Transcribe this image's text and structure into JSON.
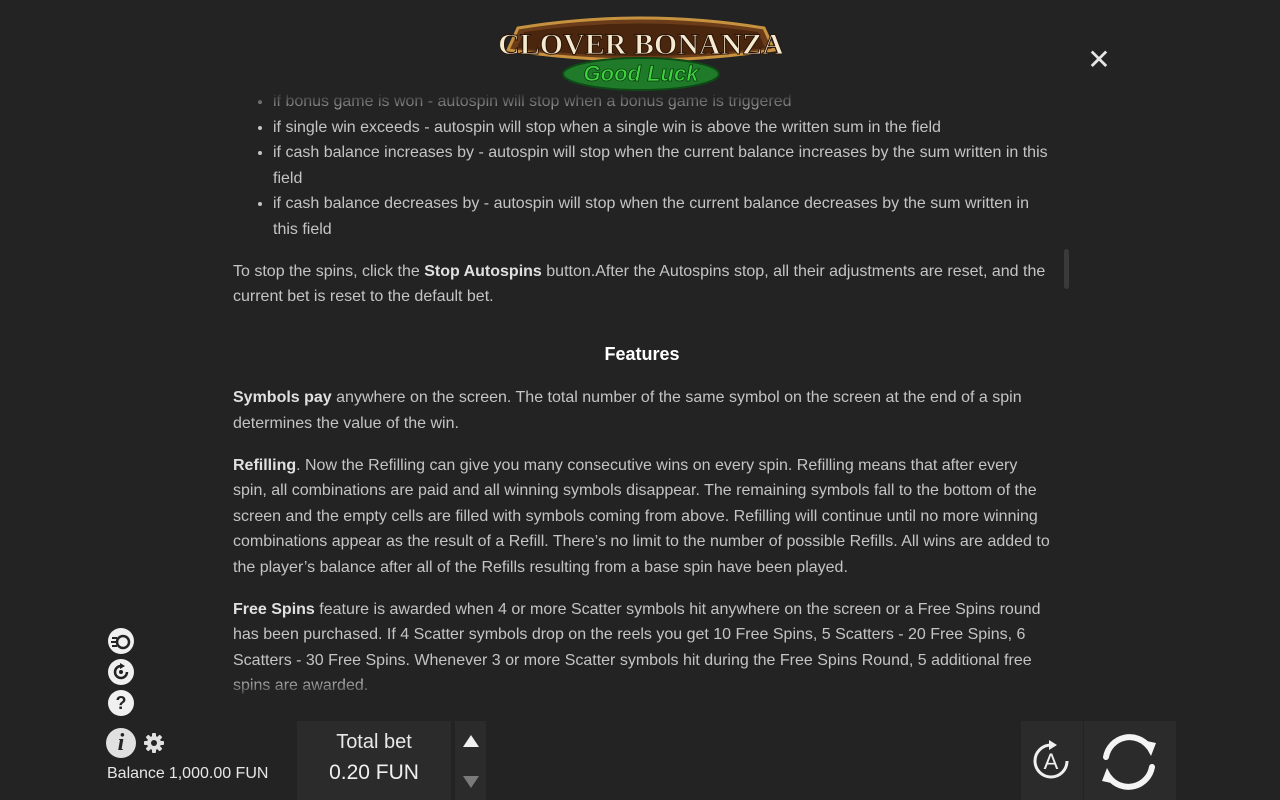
{
  "logo": {
    "line1": "CLOVER BONANZA",
    "line2": "Good Luck"
  },
  "close": {
    "icon": "close-icon",
    "glyph": "✕"
  },
  "rules": {
    "bullets": [
      "if bonus game is won - autospin will stop when a bonus game is triggered",
      "if single win exceeds - autospin will stop when a single win is above the written sum in the field",
      "if cash balance increases by - autospin will stop when the current balance increases by the sum written in this field",
      "if cash balance decreases by - autospin will stop when the current balance decreases by the sum written in this field"
    ],
    "stop_para": {
      "prefix": "To stop the spins, click the ",
      "bold": "Stop Autospins",
      "suffix": " button.After the Autospins stop, all their adjustments are reset, and the current bet is reset to the default bet."
    },
    "features_title": "Features",
    "symbols_para": {
      "bold": "Symbols pay",
      "text": " anywhere on the screen. The total number of the same symbol on the screen at the end of a spin determines the value of the win."
    },
    "refill_para": {
      "bold": "Refilling",
      "text": ". Now the Refilling can give you many consecutive wins on every spin. Refilling means that after every spin, all combinations are paid and all winning symbols disappear. The remaining symbols fall to the bottom of the screen and the empty cells are filled with symbols coming from above. Refilling will continue until no more winning combinations appear as the result of a Refill. There’s no limit to the number of possible Refills. All wins are added to the player’s balance after all of the Refills resulting from a base spin have been played."
    },
    "freespins_para": {
      "bold": "Free Spins",
      "text": " feature is awarded when 4 or more Scatter symbols hit anywhere on the screen or a Free Spins round has been purchased. If 4 Scatter symbols drop on the reels you get 10 Free Spins, 5 Scatters - 20 Free Spins, 6 Scatters - 30 Free Spins. Whenever 3 or more Scatter symbols hit during the Free Spins Round, 5 additional free spins are awarded."
    }
  },
  "side_icons": {
    "turbo": "turbo-icon",
    "history": "history-icon",
    "help": {
      "icon": "help-icon",
      "glyph": "?"
    },
    "info": {
      "icon": "info-icon",
      "glyph": "i"
    },
    "settings": "gear-icon"
  },
  "balance": {
    "label": "Balance",
    "value": "1,000.00 FUN"
  },
  "bet": {
    "label": "Total bet",
    "value": "0.20 FUN"
  },
  "autoplay": {
    "icon": "autoplay-icon",
    "glyph": "A"
  },
  "spin": {
    "icon": "spin-icon"
  },
  "colors": {
    "background": "#232323",
    "panel": "#2b2b2b",
    "logo_wood": "#6b3c1a",
    "logo_green": "#3fd23f"
  }
}
